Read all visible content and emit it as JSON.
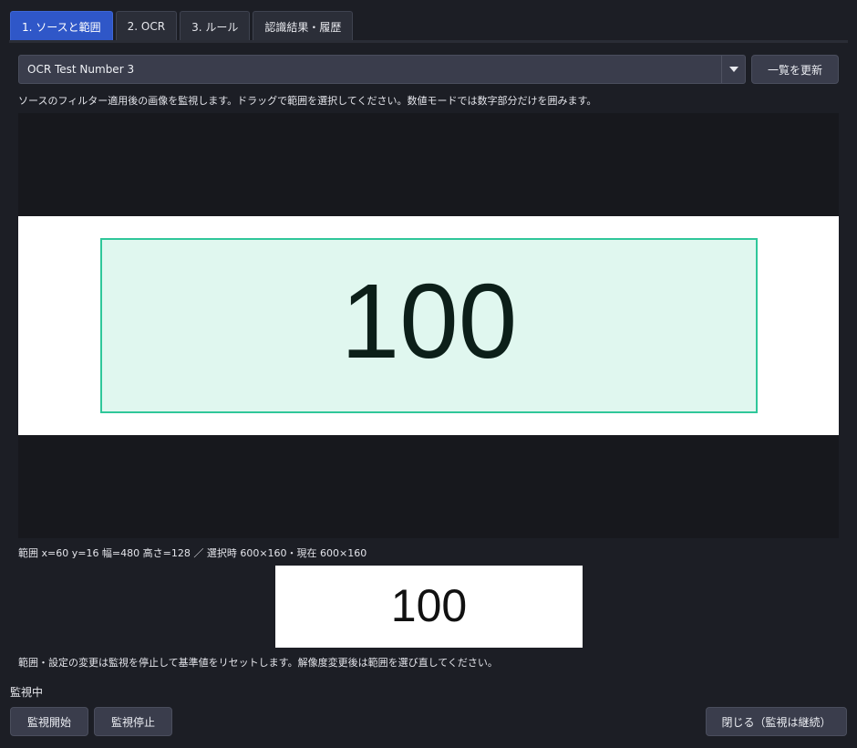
{
  "tabs": [
    {
      "label": "1. ソースと範囲",
      "active": true
    },
    {
      "label": "2. OCR",
      "active": false
    },
    {
      "label": "3. ルール",
      "active": false
    },
    {
      "label": "認識結果・履歴",
      "active": false
    }
  ],
  "source": {
    "selected": "OCR Test Number 3",
    "refresh_label": "一覧を更新"
  },
  "hint_top": "ソースのフィルター適用後の画像を監視します。ドラッグで範囲を選択してください。数値モードでは数字部分だけを囲みます。",
  "viewer": {
    "frame_text": "100",
    "selection_color": "#2fc79a"
  },
  "range_info": "範囲 x=60 y=16 幅=480 高さ=128 ／ 選択時 600×160・現在 600×160",
  "preview_text": "100",
  "hint_bottom": "範囲・設定の変更は監視を停止して基準値をリセットします。解像度変更後は範囲を選び直してください。",
  "status": "監視中",
  "buttons": {
    "start": "監視開始",
    "stop": "監視停止",
    "close": "閉じる（監視は継続）"
  },
  "colors": {
    "accent": "#2f57c8",
    "background": "#1c1e25"
  }
}
